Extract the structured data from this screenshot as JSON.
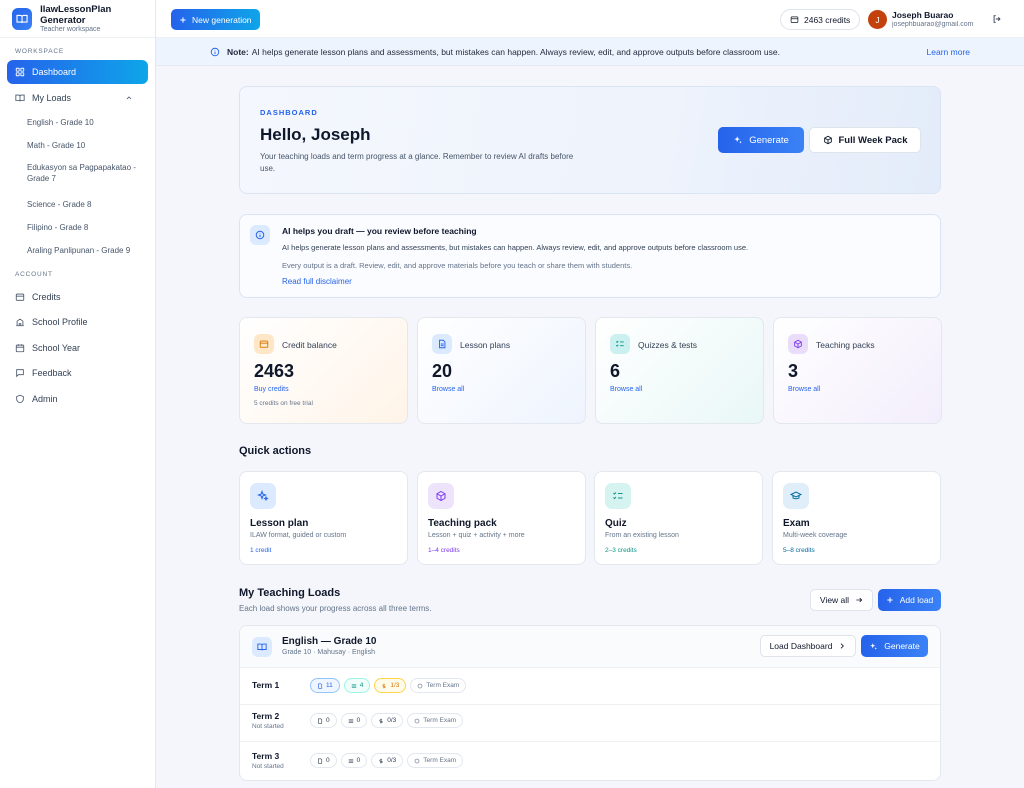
{
  "app": {
    "name": "IlawLessonPlan Generator",
    "subtitle": "Teacher workspace"
  },
  "sidebar": {
    "workspace_label": "WORKSPACE",
    "dashboard": "Dashboard",
    "my_loads": "My Loads",
    "loads": [
      "English - Grade 10",
      "Math - Grade 10",
      "Edukasyon sa Pagpapakatao - Grade 7",
      "Science - Grade 8",
      "Filipino - Grade 8",
      "Araling Panlipunan - Grade 9"
    ],
    "account_label": "ACCOUNT",
    "account_items": [
      "Credits",
      "School Profile",
      "School Year",
      "Feedback",
      "Admin"
    ]
  },
  "topbar": {
    "new_generation": "New generation",
    "credits": "2463 credits",
    "avatar_initial": "J",
    "user_name": "Joseph Buarao",
    "user_email": "josephbuarao@gmail.com"
  },
  "banner": {
    "label": "Note:",
    "text": "AI helps generate lesson plans and assessments, but mistakes can happen. Always review, edit, and approve outputs before classroom use.",
    "link": "Learn more"
  },
  "hero": {
    "label": "DASHBOARD",
    "title": "Hello, Joseph",
    "desc": "Your teaching loads and term progress at a glance. Remember to review AI drafts before use.",
    "generate": "Generate",
    "full_week": "Full Week Pack"
  },
  "disclaimer": {
    "title": "AI helps you draft — you review before teaching",
    "line1": "AI helps generate lesson plans and assessments, but mistakes can happen. Always review, edit, and approve outputs before classroom use.",
    "line2": "Every output is a draft. Review, edit, and approve materials before you teach or share them with students.",
    "link": "Read full disclaimer"
  },
  "stats": [
    {
      "label": "Credit balance",
      "value": "2463",
      "action": "Buy credits",
      "note": "5 credits on free trial"
    },
    {
      "label": "Lesson plans",
      "value": "20",
      "action": "Browse all"
    },
    {
      "label": "Quizzes & tests",
      "value": "6",
      "action": "Browse all"
    },
    {
      "label": "Teaching packs",
      "value": "3",
      "action": "Browse all"
    }
  ],
  "quick_actions": {
    "title": "Quick actions",
    "items": [
      {
        "title": "Lesson plan",
        "desc": "ILAW format, guided or custom",
        "cost": "1 credit"
      },
      {
        "title": "Teaching pack",
        "desc": "Lesson + quiz + activity + more",
        "cost": "1–4 credits"
      },
      {
        "title": "Quiz",
        "desc": "From an existing lesson",
        "cost": "2–3 credits"
      },
      {
        "title": "Exam",
        "desc": "Multi-week coverage",
        "cost": "5–8 credits"
      }
    ]
  },
  "loads": {
    "title": "My Teaching Loads",
    "subtitle": "Each load shows your progress across all three terms.",
    "view_all": "View all",
    "add_load": "Add load",
    "card": {
      "title": "English — Grade 10",
      "sub": "Grade 10 · Mahusay · English",
      "dashboard_btn": "Load Dashboard",
      "generate_btn": "Generate",
      "terms": [
        {
          "name": "Term 1",
          "status": "",
          "lessons": "11",
          "quizzes": "4",
          "progress": "1/3",
          "exam": "Term Exam"
        },
        {
          "name": "Term 2",
          "status": "Not started",
          "lessons": "0",
          "quizzes": "0",
          "progress": "0/3",
          "exam": "Term Exam"
        },
        {
          "name": "Term 3",
          "status": "Not started",
          "lessons": "0",
          "quizzes": "0",
          "progress": "0/3",
          "exam": "Term Exam"
        }
      ]
    }
  },
  "colors": {
    "primary": "#2563eb",
    "accent": "#0ea5e9",
    "avatar": "#c2410c"
  }
}
